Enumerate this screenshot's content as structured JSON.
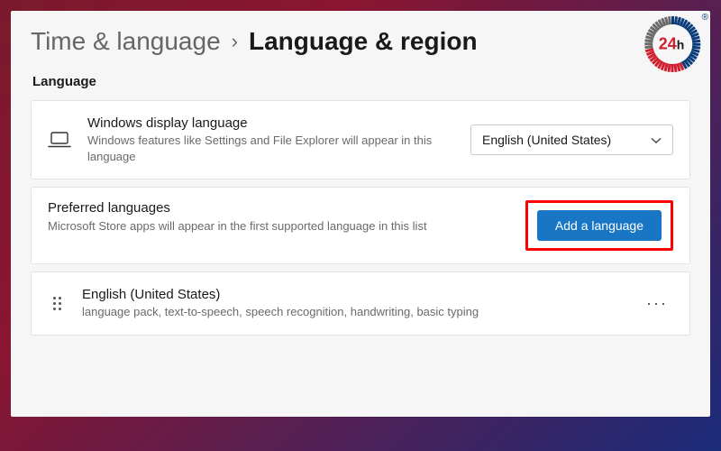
{
  "breadcrumb": {
    "parent": "Time & language",
    "current": "Language & region"
  },
  "section": {
    "title": "Language"
  },
  "displayLanguage": {
    "title": "Windows display language",
    "desc": "Windows features like Settings and File Explorer will appear in this language",
    "selected": "English (United States)"
  },
  "preferred": {
    "title": "Preferred languages",
    "desc": "Microsoft Store apps will appear in the first supported language in this list",
    "addButton": "Add a language"
  },
  "languageItem": {
    "name": "English (United States)",
    "features": "language pack, text-to-speech, speech recognition, handwriting, basic typing"
  },
  "logo": {
    "num": "24",
    "suffix": "h",
    "reg": "®"
  }
}
